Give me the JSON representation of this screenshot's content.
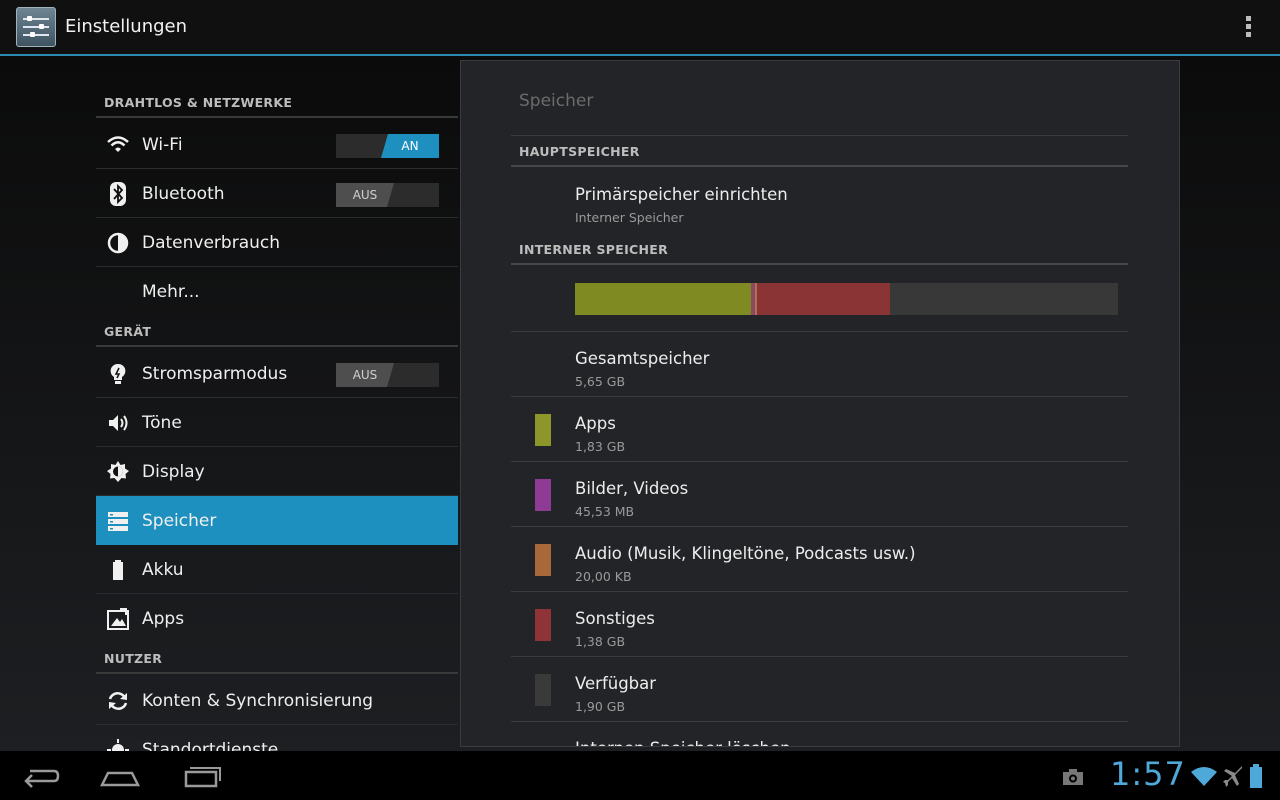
{
  "header": {
    "title": "Einstellungen",
    "app_icon": "settings-sliders-icon",
    "overflow_icon": "overflow-menu-icon"
  },
  "sidebar": {
    "sections": [
      {
        "title": "DRAHTLOS & NETZWERKE"
      },
      {
        "title": "GERÄT"
      },
      {
        "title": "NUTZER"
      }
    ],
    "items": [
      {
        "label": "Wi-Fi",
        "icon": "wifi-icon",
        "toggle": "AN"
      },
      {
        "label": "Bluetooth",
        "icon": "bluetooth-icon",
        "toggle": "AUS"
      },
      {
        "label": "Datenverbrauch",
        "icon": "data-usage-icon"
      },
      {
        "label": "Mehr..."
      },
      {
        "label": "Stromsparmodus",
        "icon": "bulb-icon",
        "toggle": "AUS"
      },
      {
        "label": "Töne",
        "icon": "speaker-icon"
      },
      {
        "label": "Display",
        "icon": "brightness-icon"
      },
      {
        "label": "Speicher",
        "icon": "storage-icon",
        "selected": true
      },
      {
        "label": "Akku",
        "icon": "battery-icon"
      },
      {
        "label": "Apps",
        "icon": "apps-icon"
      },
      {
        "label": "Konten & Synchronisierung",
        "icon": "sync-icon"
      },
      {
        "label": "Standortdienste",
        "icon": "location-icon"
      }
    ]
  },
  "detail": {
    "title": "Speicher",
    "sections": {
      "main": "HAUPTSPEICHER",
      "internal": "INTERNER SPEICHER"
    },
    "primary": {
      "title": "Primärspeicher einrichten",
      "subtitle": "Interner Speicher"
    },
    "total": {
      "title": "Gesamtspeicher",
      "value": "5,65 GB"
    },
    "usage_bar": [
      {
        "name": "Apps",
        "fraction": 0.324,
        "color": "#7f8a22"
      },
      {
        "name": "Bilder, Videos",
        "fraction": 0.008,
        "color": "#8a4a63"
      },
      {
        "name": "Audio",
        "fraction": 0.004,
        "color": "#b27050"
      },
      {
        "name": "Sonstiges",
        "fraction": 0.244,
        "color": "#8a3436"
      },
      {
        "name": "Verfügbar",
        "fraction": 0.42,
        "color": "#383838"
      }
    ],
    "categories": [
      {
        "title": "Apps",
        "value": "1,83 GB",
        "color": "#8c962a"
      },
      {
        "title": "Bilder, Videos",
        "value": "45,53 MB",
        "color": "#8e3b96"
      },
      {
        "title": "Audio (Musik, Klingeltöne, Podcasts usw.)",
        "value": "20,00 KB",
        "color": "#a8683a"
      },
      {
        "title": "Sonstiges",
        "value": "1,38 GB",
        "color": "#8e3436"
      },
      {
        "title": "Verfügbar",
        "value": "1,90 GB",
        "color": "#3a3a3a"
      }
    ],
    "erase": {
      "title": "Internen Speicher löschen"
    }
  },
  "navbar": {
    "back_icon": "back-icon",
    "home_icon": "home-icon",
    "recents_icon": "recent-apps-icon"
  },
  "status": {
    "time": "1:57",
    "icons": [
      "screenshot-icon",
      "wifi-status-icon",
      "airplane-icon",
      "battery-status-icon"
    ]
  },
  "colors": {
    "accent": "#1e90c0",
    "clock": "#4fa9d8"
  }
}
